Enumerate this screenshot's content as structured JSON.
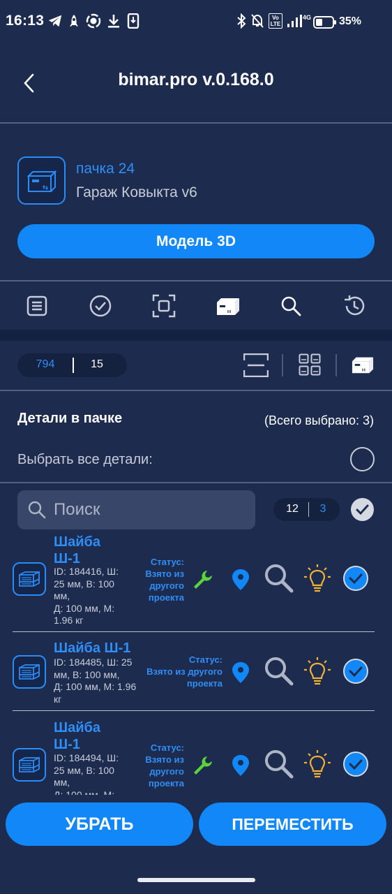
{
  "status_bar": {
    "time": "16:13",
    "battery": "35%",
    "network": "4G",
    "volte": "Vo LTE"
  },
  "header": {
    "title": "bimar.pro v.0.168.0",
    "back_icon": "chevron-left-icon"
  },
  "pack": {
    "name": "пачка 24",
    "project": "Гараж Ковыкта v6",
    "model_button": "Модель 3D"
  },
  "tabs": [
    {
      "icon": "list-icon"
    },
    {
      "icon": "check-circle-icon"
    },
    {
      "icon": "scan-frame-icon"
    },
    {
      "icon": "package-icon",
      "active": true
    },
    {
      "icon": "search-icon"
    },
    {
      "icon": "history-icon"
    }
  ],
  "counter": {
    "total": "794",
    "in_pack": "15"
  },
  "details": {
    "title": "Детали в пачке",
    "selected_count": "(Всего выбрано: 3)",
    "select_all": "Выбрать все детали:"
  },
  "search": {
    "placeholder": "Поиск",
    "count_a": "12",
    "count_b": "3"
  },
  "items": [
    {
      "title": "Шайба\nШ-1",
      "desc": "ID: 184416, Ш:\n25 мм, В: 100\nмм,\nД: 100 мм, М:\n1.96 кг",
      "status": "Статус:\nВзято из\nдругого\nпроекта",
      "has_wrench": true,
      "checked": true
    },
    {
      "title": "Шайба Ш-1",
      "desc": "ID: 184485, Ш: 25\nмм, В: 100 мм,\nД: 100 мм, М: 1.96\nкг",
      "status": "Статус:\nВзято из другого\nпроекта",
      "has_wrench": false,
      "checked": true
    },
    {
      "title": "Шайба\nШ-1",
      "desc": "ID: 184494, Ш:\n25 мм, В: 100\nмм,\nД: 100 мм, М:",
      "status": "Статус:\nВзято из\nдругого\nпроекта",
      "has_wrench": true,
      "checked": true
    }
  ],
  "actions": {
    "remove": "УБРАТЬ",
    "move": "ПЕРЕМЕСТИТЬ"
  },
  "colors": {
    "background": "#1d2b4e",
    "accent": "#1287f7",
    "link": "#2f8ff8",
    "wrench": "#5bd33a",
    "bulb": "#f2b233"
  }
}
